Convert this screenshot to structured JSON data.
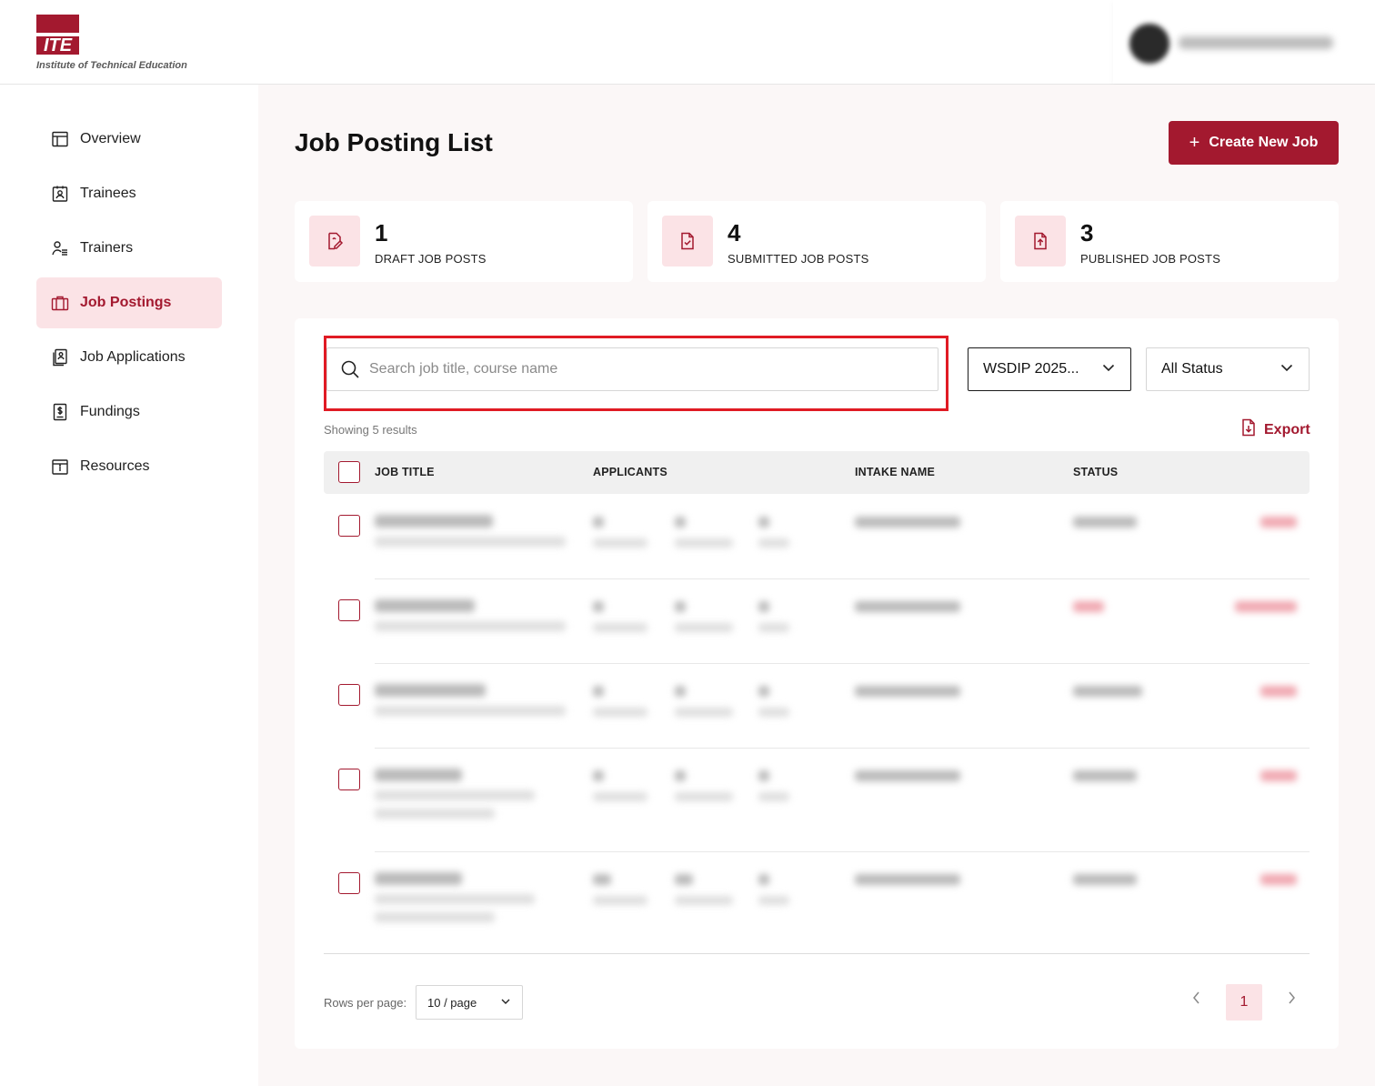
{
  "brand": {
    "logo_mark": "ITE",
    "logo_text": "Institute of Technical Education",
    "accent": "#a3192f"
  },
  "sidebar": {
    "items": [
      {
        "label": "Overview",
        "icon": "layout-icon"
      },
      {
        "label": "Trainees",
        "icon": "id-badge-icon"
      },
      {
        "label": "Trainers",
        "icon": "user-list-icon"
      },
      {
        "label": "Job Postings",
        "icon": "briefcase-icon",
        "active": true
      },
      {
        "label": "Job Applications",
        "icon": "applications-icon"
      },
      {
        "label": "Fundings",
        "icon": "funding-document-icon"
      },
      {
        "label": "Resources",
        "icon": "info-calendar-icon"
      }
    ]
  },
  "main": {
    "title": "Job Posting List",
    "create_button": "Create New Job",
    "stats": [
      {
        "value": "1",
        "label": "DRAFT JOB POSTS",
        "icon": "edit-document-icon"
      },
      {
        "value": "4",
        "label": "SUBMITTED JOB POSTS",
        "icon": "check-document-icon"
      },
      {
        "value": "3",
        "label": "PUBLISHED JOB POSTS",
        "icon": "upload-document-icon"
      }
    ],
    "search": {
      "placeholder": "Search job title, course name",
      "value": ""
    },
    "intake_filter": "WSDIP 2025...",
    "status_filter": "All Status",
    "showing": "Showing 5 results",
    "export_label": "Export",
    "table": {
      "headers": [
        "JOB TITLE",
        "APPLICANTS",
        "INTAKE NAME",
        "STATUS"
      ]
    },
    "pagination": {
      "rows_per_page_label": "Rows per page:",
      "page_size": "10 / page",
      "current_page": "1"
    }
  }
}
